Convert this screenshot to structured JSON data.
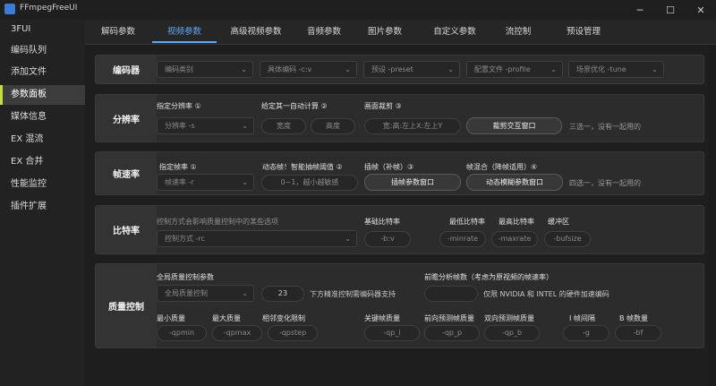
{
  "window": {
    "title": "FFmpegFreeUI",
    "minimize": "─",
    "maximize": "☐",
    "close": "✕"
  },
  "sidebar": {
    "items": [
      {
        "label": "3FUI"
      },
      {
        "label": "编码队列"
      },
      {
        "label": "添加文件"
      },
      {
        "label": "参数面板"
      },
      {
        "label": "媒体信息"
      },
      {
        "label": "EX 混流"
      },
      {
        "label": "EX 合并"
      },
      {
        "label": "性能监控"
      },
      {
        "label": "插件扩展"
      }
    ],
    "active_index": 3
  },
  "tabs": [
    {
      "label": "解码参数"
    },
    {
      "label": "视频参数"
    },
    {
      "label": "高级视频参数"
    },
    {
      "label": "音频参数"
    },
    {
      "label": "图片参数"
    },
    {
      "label": "自定义参数"
    },
    {
      "label": "流控制"
    },
    {
      "label": "预设管理"
    }
  ],
  "active_tab": 1,
  "encoder": {
    "title": "编码器",
    "category": "编码类别",
    "codec": "具体编码 -c:v",
    "preset": "预设 -preset",
    "profile": "配置文件 -profile",
    "tune": "场景优化 -tune"
  },
  "resolution": {
    "title": "分辨率",
    "label_set": "指定分辨率 ①",
    "label_auto": "给定其一自动计算 ②",
    "label_crop": "画面裁剪 ③",
    "size_combo": "分辨率 -s",
    "width_ph": "宽度",
    "height_ph": "高度",
    "crop_ph": "宽:高:左上X:左上Y",
    "crop_btn": "裁剪交互窗口",
    "hint": "三选一，没有一起用的"
  },
  "framerate": {
    "title": "帧速率",
    "label_set": "指定帧率 ①",
    "label_dynamic": "动态帧！智能抽帧阈值 ②",
    "label_interp": "插帧（补帧）③",
    "label_blend": "帧混合（降帧适用）④",
    "rate_combo": "帧速率 -r",
    "threshold_ph": "0~1，越小越敏感",
    "interp_btn": "插帧参数窗口",
    "blend_btn": "动态模糊参数窗口",
    "hint": "四选一，没有一起用的"
  },
  "bitrate": {
    "title": "比特率",
    "label_mode": "控制方式会影响质量控制中的某些选项",
    "label_base": "基础比特率",
    "label_min": "最低比特率",
    "label_max": "最高比特率",
    "label_buf": "缓冲区",
    "mode_combo": "控制方式 -rc",
    "base_ph": "-b:v",
    "min_ph": "-minrate",
    "max_ph": "-maxrate",
    "buf_ph": "-bufsize"
  },
  "quality": {
    "title": "质量控制",
    "label_global": "全局质量控制参数",
    "global_combo": "全局质量控制",
    "global_value": "23",
    "global_hint": "下方精准控制需编码器支持",
    "label_lookahead": "前瞻分析帧数（考虑为原视频的帧速率）",
    "lookahead_hint": "仅限 NVIDIA 和 INTEL 的硬件加速编码",
    "label_qmin": "最小质量",
    "label_qmax": "最大质量",
    "label_qstep": "相邻变化限制",
    "label_qi": "关键帧质量",
    "label_qp": "前向预测帧质量",
    "label_qb": "双向预测帧质量",
    "label_g": "I 帧间隔",
    "label_bf": "B 帧数量",
    "qmin_ph": "-qpmin",
    "qmax_ph": "-qpmax",
    "qstep_ph": "-qpstep",
    "qi_ph": "-qp_i",
    "qp_ph": "-qp_p",
    "qb_ph": "-qp_b",
    "g_ph": "-g",
    "bf_ph": "-bf"
  }
}
